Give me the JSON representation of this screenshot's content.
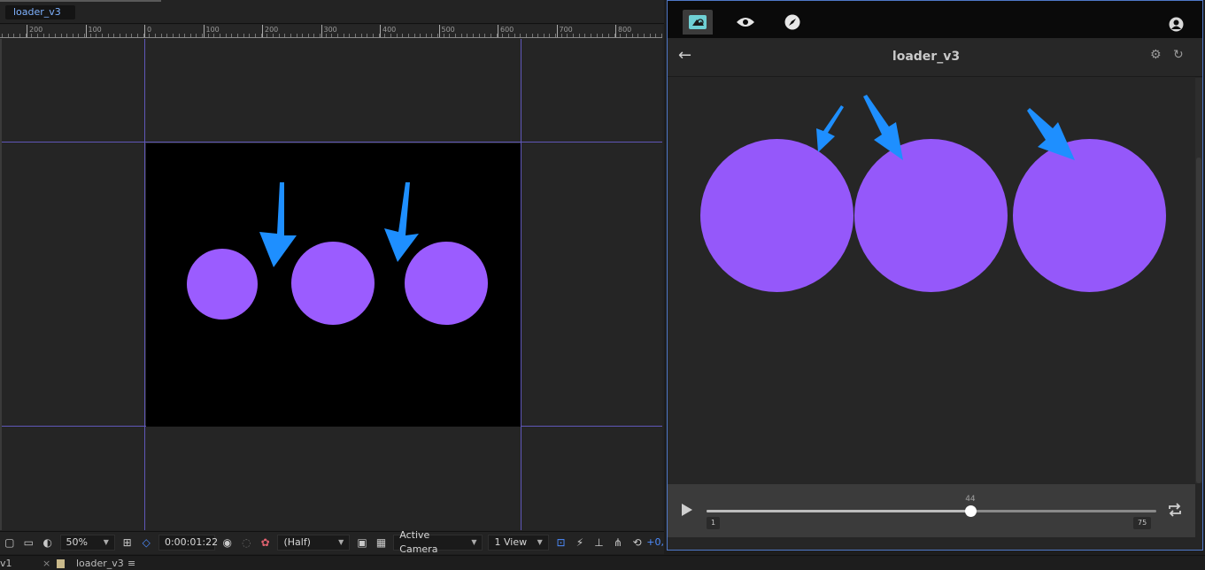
{
  "composition": {
    "tab_label": "loader_v3",
    "ruler_labels": [
      "200",
      "100",
      "0",
      "100",
      "200",
      "300",
      "400",
      "500",
      "600",
      "700",
      "800"
    ]
  },
  "toolbar": {
    "zoom": "50%",
    "timecode": "0:00:01:22",
    "resolution": "(Half)",
    "camera": "Active Camera",
    "views": "1 View",
    "exposure": "+0,"
  },
  "bottom_bar": {
    "left_fragment": "v1",
    "close_mark": "×",
    "comp_label": "loader_v3",
    "menu_mark": "≡"
  },
  "preview": {
    "title": "loader_v3",
    "back_glyph": "←",
    "current_frame": "44",
    "start_frame": "1",
    "end_frame": "75",
    "progress": 0.587
  },
  "colors": {
    "accent_blue": "#1e8fff",
    "dot_purple": "#9b5cff",
    "guide": "#5f57b8",
    "panel_border": "#4f78c8"
  }
}
